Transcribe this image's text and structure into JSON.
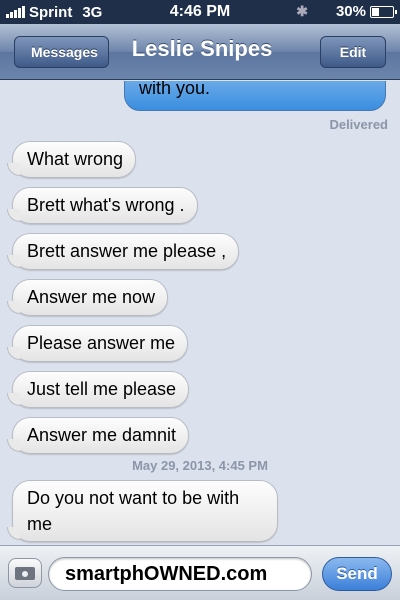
{
  "status_bar": {
    "carrier": "Sprint",
    "network": "3G",
    "time": "4:46 PM",
    "battery": "30%",
    "battery_level": 0.3
  },
  "nav": {
    "back_label": "Messages",
    "title": "Leslie Snipes",
    "edit_label": "Edit"
  },
  "conversation": {
    "sent_partial": "with you.",
    "delivered": "Delivered",
    "received_messages": [
      "What wrong",
      "Brett what's wrong .",
      "Brett answer me please ,",
      "Answer me now",
      "Please answer me",
      "Just tell me please",
      "Answer me damnit"
    ],
    "timestamp": "May 29, 2013, 4:45 PM",
    "last_message": "Do you not want to be with me"
  },
  "input_bar": {
    "text": "smartphOWNED.com",
    "send_label": "Send"
  },
  "colors": {
    "nav_bar": "#6e86ab",
    "sent_bubble": "#3a8ee0",
    "background": "#dbe2ed",
    "send_button": "#3b7fd9"
  }
}
